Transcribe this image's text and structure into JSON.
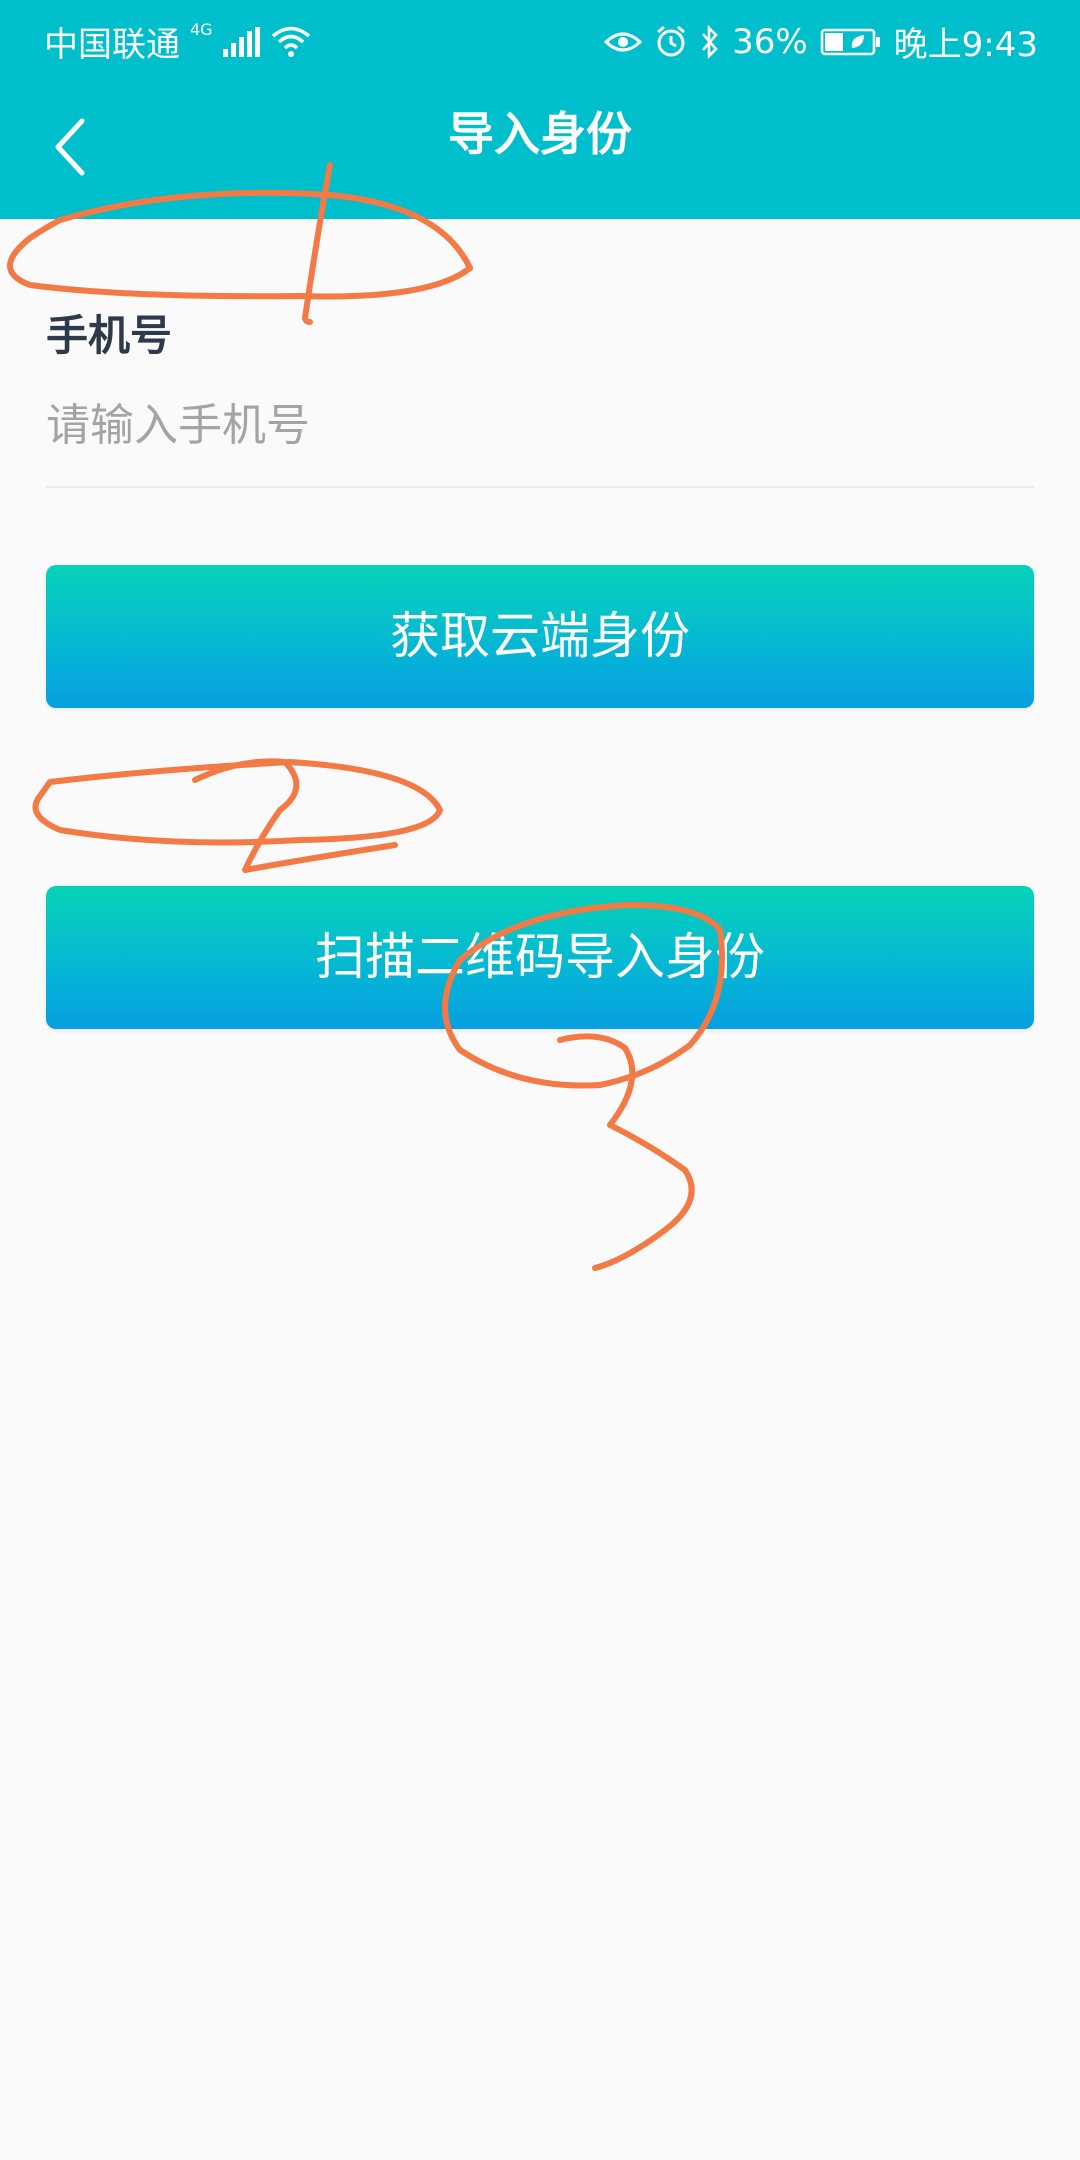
{
  "status_bar": {
    "carrier": "中国联通",
    "network_type": "4G",
    "battery_percent": "36%",
    "time": "晚上9:43"
  },
  "app_bar": {
    "title": "导入身份"
  },
  "form": {
    "phone_label": "手机号",
    "phone_placeholder": "请输入手机号",
    "phone_value": ""
  },
  "actions": {
    "get_cloud_identity": "获取云端身份",
    "scan_qr_import": "扫描二维码导入身份"
  },
  "colors": {
    "app_bar": "#00bfcc",
    "button_gradient_top": "#06d3b8",
    "button_gradient_bottom": "#069fe2",
    "annotation": "#f47a45"
  },
  "icons": [
    "back-arrow-icon",
    "signal-icon",
    "wifi-icon",
    "eye-icon",
    "alarm-icon",
    "bluetooth-icon",
    "battery-icon"
  ]
}
